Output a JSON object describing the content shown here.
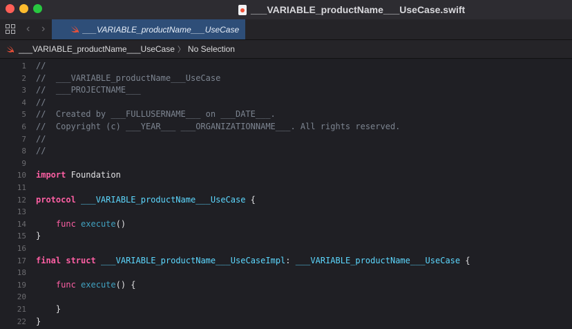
{
  "window": {
    "title": "___VARIABLE_productName___UseCase.swift",
    "icon": "swift-file-icon"
  },
  "tab": {
    "label": "___VARIABLE_productName___UseCase",
    "icon": "swift-icon"
  },
  "jumpbar": {
    "file": "___VARIABLE_productName___UseCase",
    "separator": "〉",
    "selection": "No Selection"
  },
  "colors": {
    "comment": "#7c8490",
    "keyword": "#fc5fa3",
    "type": "#5dd8ff",
    "function": "#41a1c0",
    "plain": "#e1e1e3",
    "tab_active": "#2e4e78"
  },
  "code": {
    "line_numbers": [
      "1",
      "2",
      "3",
      "4",
      "5",
      "6",
      "7",
      "8",
      "9",
      "10",
      "11",
      "12",
      "13",
      "14",
      "15",
      "16",
      "17",
      "18",
      "19",
      "20",
      "21",
      "22"
    ],
    "l1": "//",
    "l2": "//  ___VARIABLE_productName___UseCase",
    "l3": "//  ___PROJECTNAME___",
    "l4": "//",
    "l5": "//  Created by ___FULLUSERNAME___ on ___DATE___.",
    "l6": "//  Copyright (c) ___YEAR___ ___ORGANIZATIONNAME___. All rights reserved.",
    "l7": "//",
    "l8": "//",
    "l10_kw": "import",
    "l10_name": " Foundation",
    "l12_kw": "protocol",
    "l12_type": "___VARIABLE_productName___UseCase",
    "l12_brace": " {",
    "l14_indent": "    ",
    "l14_kw": "func",
    "l14_fn": "execute",
    "l14_tail": "()",
    "l15": "}",
    "l17_kw1": "final",
    "l17_kw2": "struct",
    "l17_type": "___VARIABLE_productName___UseCaseImpl",
    "l17_colon": ": ",
    "l17_type2": "___VARIABLE_productName___UseCase",
    "l17_brace": " {",
    "l19_indent": "    ",
    "l19_kw": "func",
    "l19_fn": "execute",
    "l19_tail": "() {",
    "l21": "    }",
    "l22": "}"
  }
}
